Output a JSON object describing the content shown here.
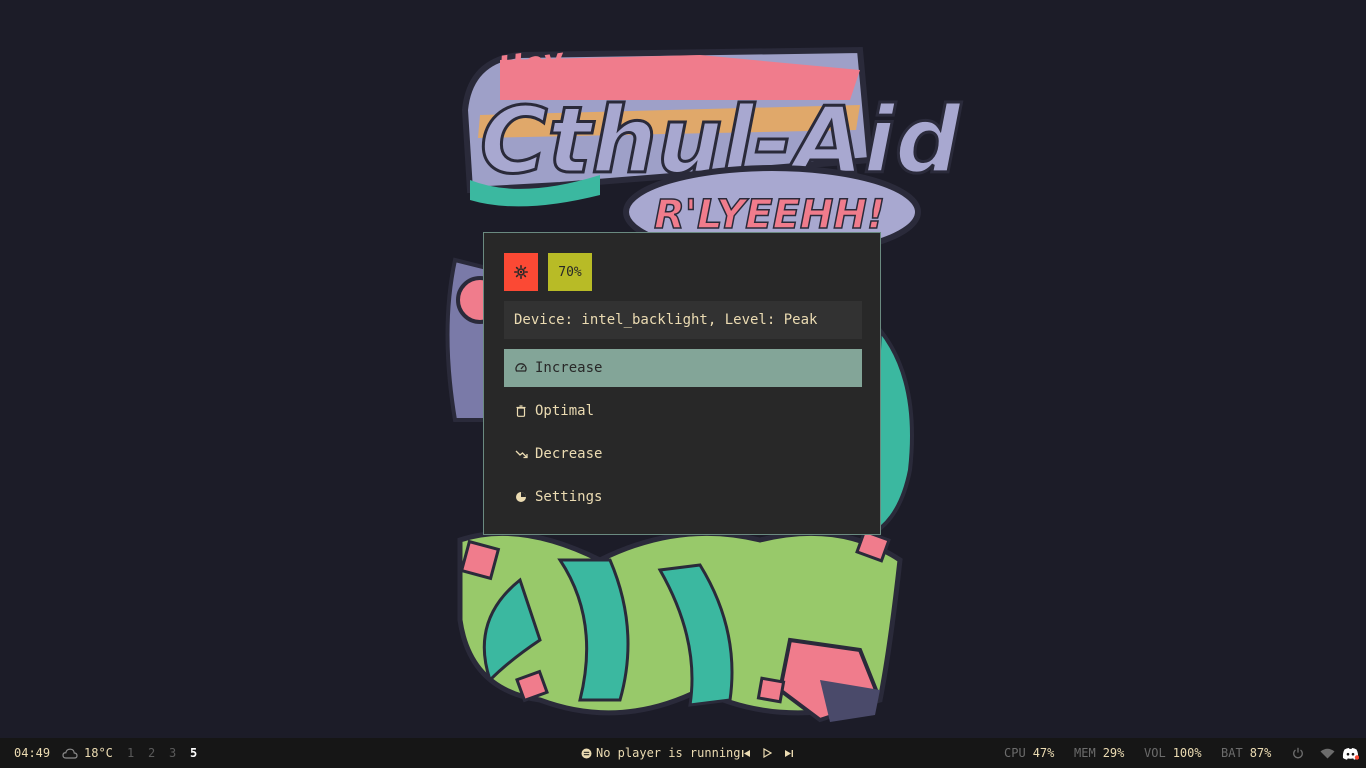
{
  "wallpaper": {
    "title_small": "Hey",
    "title_main": "Cthul-Aid",
    "slogan": "R'LYEEHH!"
  },
  "brightness_menu": {
    "icon": "brightness-icon",
    "level_badge": "70%",
    "device_info": "Device: intel_backlight, Level: Peak",
    "items": [
      {
        "label": "Increase",
        "icon": "speedometer-icon",
        "selected": true
      },
      {
        "label": "Optimal",
        "icon": "trash-icon",
        "selected": false
      },
      {
        "label": "Decrease",
        "icon": "trend-down-icon",
        "selected": false
      },
      {
        "label": "Settings",
        "icon": "pie-settings-icon",
        "selected": false
      }
    ]
  },
  "bar": {
    "time": "04:49",
    "weather_icon": "cloud-icon",
    "temperature": "18°C",
    "workspaces": [
      "1",
      "2",
      "3",
      "5"
    ],
    "active_workspace": "5",
    "player_icon": "music-disc-icon",
    "player_status": "No player is running",
    "cpu_label": "CPU",
    "cpu_value": "47%",
    "mem_label": "MEM",
    "mem_value": "29%",
    "vol_label": "VOL",
    "vol_value": "100%",
    "bat_label": "BAT",
    "bat_value": "87%"
  },
  "colors": {
    "menu_bg": "#282828",
    "accent_red": "#fb4934",
    "accent_yellow": "#b8bb26",
    "selected_bg": "#83a598",
    "text": "#ebdbb2",
    "wallpaper_bg": "#1c1c28"
  }
}
